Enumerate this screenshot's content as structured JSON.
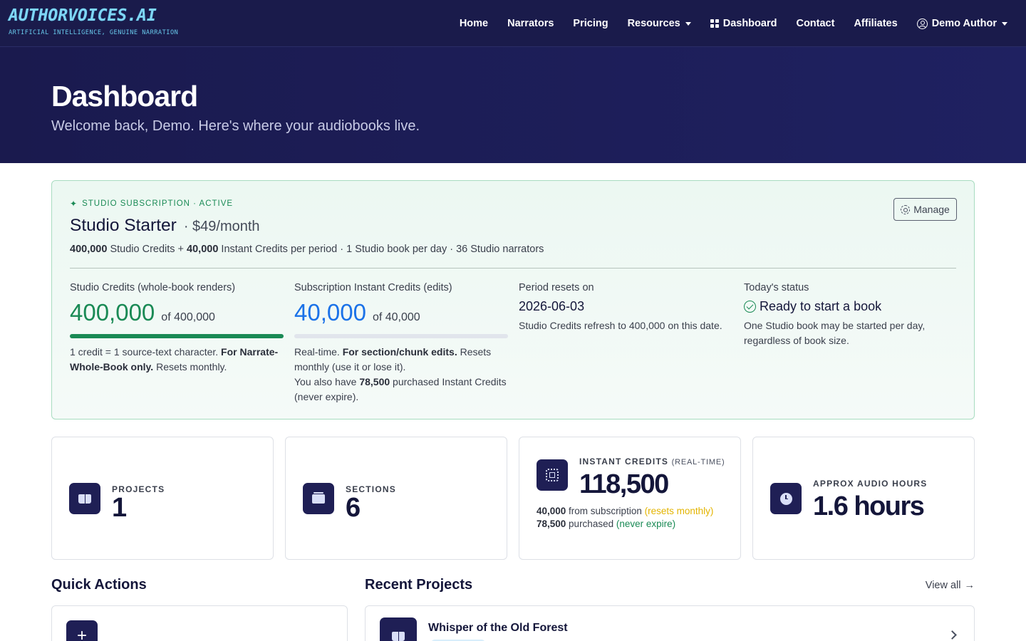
{
  "brand": {
    "title": "AUTHORVOICES.AI",
    "tagline": "ARTIFICIAL INTELLIGENCE, GENUINE NARRATION"
  },
  "nav": {
    "home": "Home",
    "narrators": "Narrators",
    "pricing": "Pricing",
    "resources": "Resources",
    "dashboard": "Dashboard",
    "contact": "Contact",
    "affiliates": "Affiliates",
    "user": "Demo Author"
  },
  "hero": {
    "title": "Dashboard",
    "subtitle": "Welcome back, Demo. Here's where your audiobooks live."
  },
  "subscription": {
    "badge": "STUDIO SUBSCRIPTION · ACTIVE",
    "manage_label": "Manage",
    "plan_name": "Studio Starter",
    "price": "· $49/month",
    "desc": {
      "studio_credits": "400,000",
      "part1": " Studio Credits + ",
      "instant_credits": "40,000",
      "part2": " Instant Credits per period · 1 Studio book per day · 36 Studio narrators"
    },
    "studio": {
      "label": "Studio Credits (whole-book renders)",
      "value": "400,000",
      "of": "of 400,000",
      "progress": 1.0,
      "note1": "1 credit = 1 source-text character. ",
      "note_bold": "For Narrate-Whole-Book only.",
      "note2": " Resets monthly."
    },
    "instant": {
      "label": "Subscription Instant Credits (edits)",
      "value": "40,000",
      "of": "of 40,000",
      "progress": 0.0,
      "note1": "Real-time. ",
      "note_bold": "For section/chunk edits.",
      "note2": " Resets monthly (use it or lose it).",
      "note3": "You also have ",
      "purchased": "78,500",
      "note4": " purchased Instant Credits (never expire)."
    },
    "period": {
      "label": "Period resets on",
      "value": "2026-06-03",
      "note": "Studio Credits refresh to 400,000 on this date."
    },
    "status": {
      "label": "Today's status",
      "value": "Ready to start a book",
      "note": "One Studio book may be started per day, regardless of book size."
    }
  },
  "stats": {
    "projects": {
      "label": "PROJECTS",
      "value": "1"
    },
    "sections": {
      "label": "SECTIONS",
      "value": "6"
    },
    "instant": {
      "label": "INSTANT CREDITS",
      "label_small": "(REAL-TIME)",
      "value": "118,500",
      "sub_amount": "40,000",
      "sub_text": " from subscription ",
      "sub_note": "(resets monthly)",
      "purchased_amount": "78,500",
      "purchased_text": " purchased ",
      "purchased_note": "(never expire)"
    },
    "hours": {
      "label": "APPROX AUDIO HOURS",
      "value": "1.6 hours"
    }
  },
  "quick_actions": {
    "title": "Quick Actions",
    "first_icon": "+"
  },
  "recent_projects": {
    "title": "Recent Projects",
    "view_all": "View all",
    "items": [
      {
        "title": "Whisper of the Old Forest"
      }
    ]
  },
  "colors": {
    "navy": "#1a1b4b",
    "green": "#1a8a55",
    "blue": "#1b72e8",
    "amber": "#e3b400"
  }
}
